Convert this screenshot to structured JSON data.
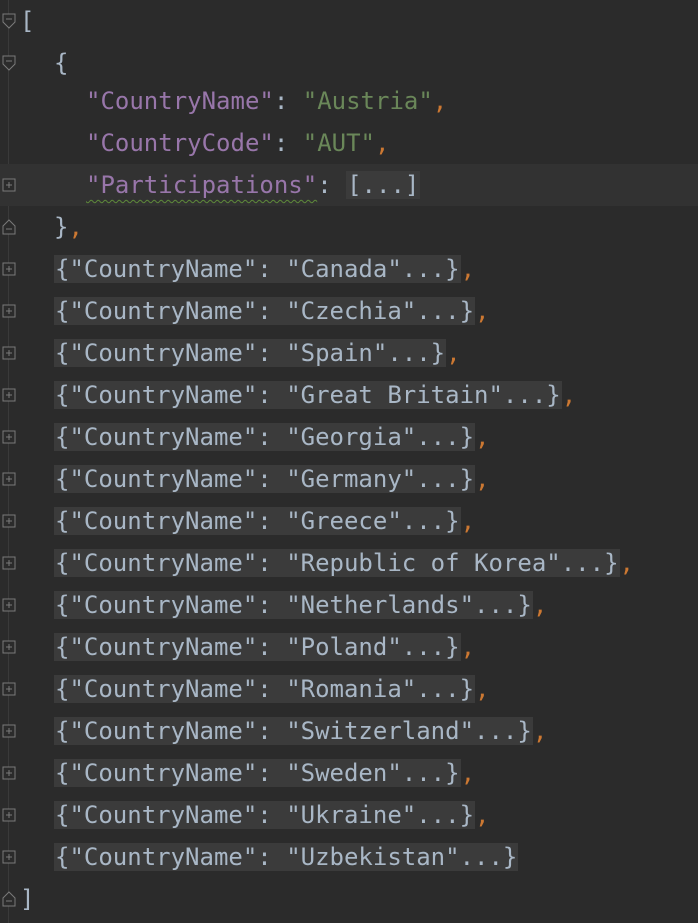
{
  "editor": {
    "open_bracket": "[",
    "close_bracket": "]",
    "open_brace": "{",
    "close_brace": "},",
    "colon": ": ",
    "comma": ",",
    "expanded": {
      "name_key": "\"CountryName\"",
      "name_value": "\"Austria\"",
      "code_key": "\"CountryCode\"",
      "code_value": "\"AUT\"",
      "participations_key": "\"Participations\"",
      "participations_folded": "[...]"
    },
    "folded_items": [
      {
        "text": "{\"CountryName\": \"Canada\"...}",
        "trailing": ","
      },
      {
        "text": "{\"CountryName\": \"Czechia\"...}",
        "trailing": ","
      },
      {
        "text": "{\"CountryName\": \"Spain\"...}",
        "trailing": ","
      },
      {
        "text": "{\"CountryName\": \"Great Britain\"...}",
        "trailing": ","
      },
      {
        "text": "{\"CountryName\": \"Georgia\"...}",
        "trailing": ","
      },
      {
        "text": "{\"CountryName\": \"Germany\"...}",
        "trailing": ","
      },
      {
        "text": "{\"CountryName\": \"Greece\"...}",
        "trailing": ","
      },
      {
        "text": "{\"CountryName\": \"Republic of Korea\"...}",
        "trailing": ","
      },
      {
        "text": "{\"CountryName\": \"Netherlands\"...}",
        "trailing": ","
      },
      {
        "text": "{\"CountryName\": \"Poland\"...}",
        "trailing": ","
      },
      {
        "text": "{\"CountryName\": \"Romania\"...}",
        "trailing": ","
      },
      {
        "text": "{\"CountryName\": \"Switzerland\"...}",
        "trailing": ","
      },
      {
        "text": "{\"CountryName\": \"Sweden\"...}",
        "trailing": ","
      },
      {
        "text": "{\"CountryName\": \"Ukraine\"...}",
        "trailing": ","
      },
      {
        "text": "{\"CountryName\": \"Uzbekistan\"...}",
        "trailing": ""
      }
    ]
  },
  "colors": {
    "background": "#2b2b2b",
    "key": "#9876aa",
    "string": "#6a8759",
    "punctuation": "#a9b7c6",
    "comma": "#cc7832",
    "folded_background": "#3b3b3b"
  },
  "icons": {
    "fold_open": "fold-collapse-icon",
    "fold_closed": "fold-expand-icon",
    "fold_end": "fold-end-icon"
  }
}
